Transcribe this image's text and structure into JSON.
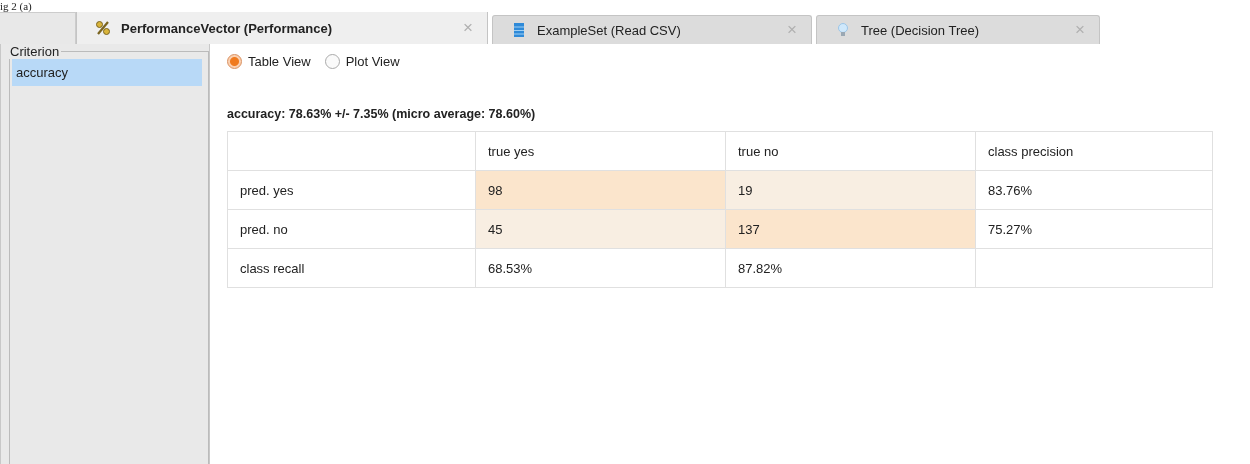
{
  "caption": "ig 2 (a)",
  "tabs": [
    {
      "label": "PerformanceVector (Performance)",
      "kind": "percent",
      "selected": true,
      "close": "×"
    },
    {
      "label": "ExampleSet (Read CSV)",
      "kind": "data",
      "selected": false,
      "close": "×"
    },
    {
      "label": "Tree (Decision Tree)",
      "kind": "bulb",
      "selected": false,
      "close": "×"
    }
  ],
  "criterion": {
    "title": "Criterion",
    "items": [
      {
        "label": "accuracy",
        "selected": true
      }
    ]
  },
  "views": [
    {
      "label": "Table View",
      "selected": true
    },
    {
      "label": "Plot View",
      "selected": false
    }
  ],
  "summary": "accuracy: 78.63% +/- 7.35% (micro average: 78.60%)",
  "table": {
    "columns": [
      "",
      "true yes",
      "true no",
      "class precision"
    ],
    "rows": [
      [
        {
          "text": "pred. yes"
        },
        {
          "text": "98",
          "color": "#fbe5cc"
        },
        {
          "text": "19",
          "color": "#f8eee2"
        },
        {
          "text": "83.76%"
        }
      ],
      [
        {
          "text": "pred. no"
        },
        {
          "text": "45",
          "color": "#f8eee2"
        },
        {
          "text": "137",
          "color": "#fbe5cc"
        },
        {
          "text": "75.27%"
        }
      ],
      [
        {
          "text": "class recall"
        },
        {
          "text": "68.53%"
        },
        {
          "text": "87.82%"
        },
        {
          "text": ""
        }
      ]
    ]
  }
}
